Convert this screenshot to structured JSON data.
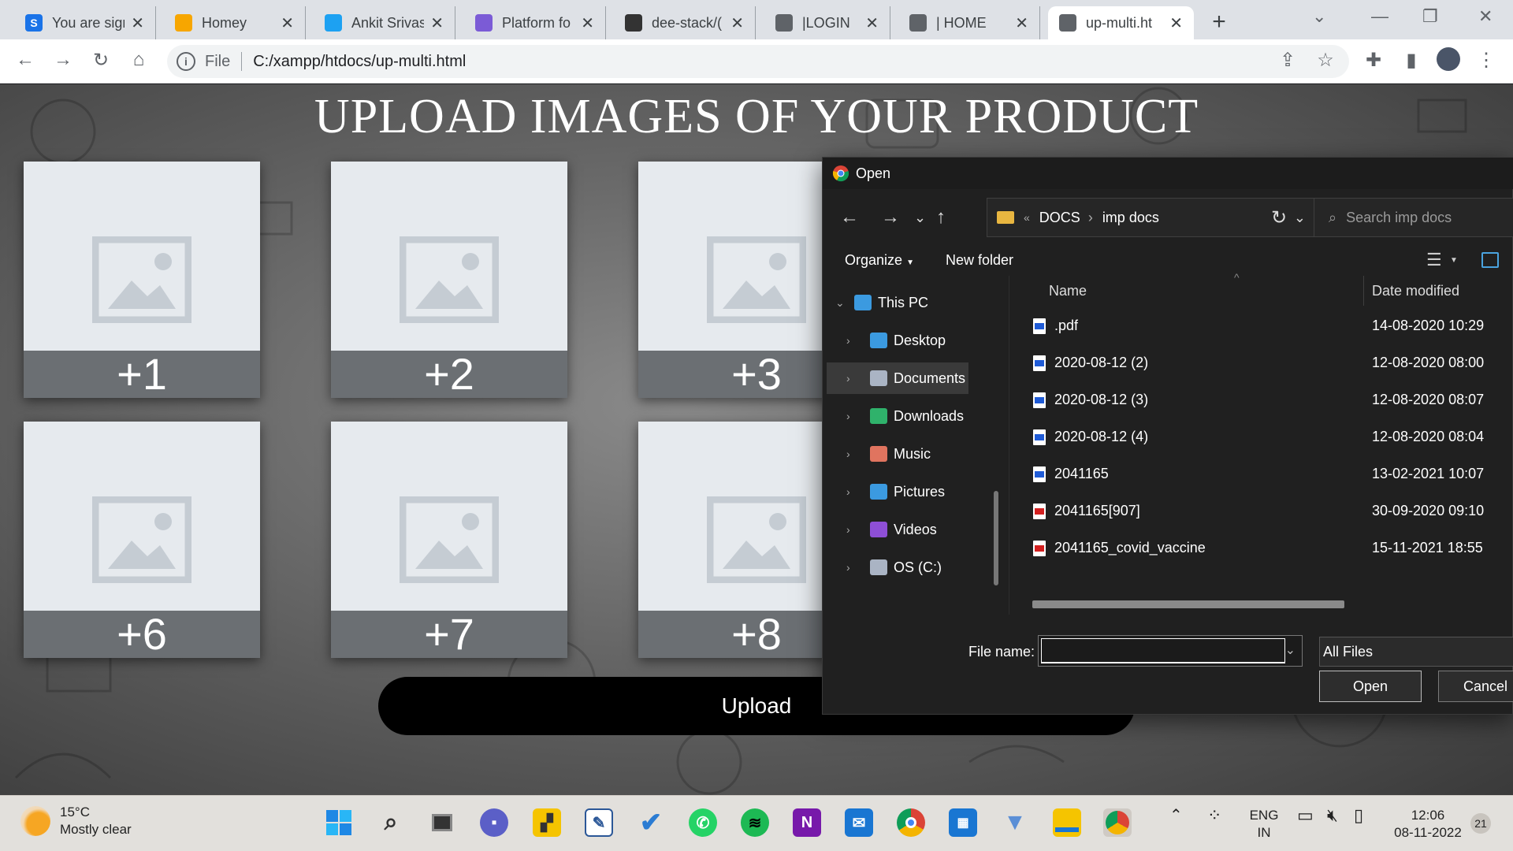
{
  "browser": {
    "tabs": [
      {
        "title": "You are sign",
        "favicon_letter": "S",
        "favicon_color": "#1a73e8",
        "active": false
      },
      {
        "title": "Homey",
        "favicon_letter": "",
        "favicon_color": "#f7a600",
        "active": false
      },
      {
        "title": "Ankit Srivas",
        "favicon_letter": "",
        "favicon_color": "#1da1f2",
        "active": false
      },
      {
        "title": "Platform fo",
        "favicon_letter": "",
        "favicon_color": "#7b5bd6",
        "active": false
      },
      {
        "title": "dee-stack/(",
        "favicon_letter": "",
        "favicon_color": "#333333",
        "active": false
      },
      {
        "title": "|LOGIN",
        "favicon_letter": "",
        "favicon_color": "#5f6368",
        "active": false
      },
      {
        "title": "| HOME",
        "favicon_letter": "",
        "favicon_color": "#5f6368",
        "active": false
      },
      {
        "title": "up-multi.ht",
        "favicon_letter": "",
        "favicon_color": "#5f6368",
        "active": true
      }
    ],
    "address": {
      "scheme_label": "File",
      "url": "C:/xampp/htdocs/up-multi.html"
    }
  },
  "page": {
    "heading": "UPLOAD IMAGES OF YOUR PRODUCT",
    "slots": [
      {
        "label": "+1"
      },
      {
        "label": "+2"
      },
      {
        "label": "+3"
      },
      {
        "label": "+6"
      },
      {
        "label": "+7"
      },
      {
        "label": "+8"
      }
    ],
    "upload_label": "Upload"
  },
  "dialog": {
    "title": "Open",
    "breadcrumb": {
      "overflow": "«",
      "parent": "DOCS",
      "current": "imp docs"
    },
    "search_placeholder": "Search imp docs",
    "organize_label": "Organize",
    "new_folder_label": "New folder",
    "nav": [
      {
        "label": "This PC",
        "icon": "pc-icon",
        "color": "#3b9ae0",
        "expanded": true
      },
      {
        "label": "Desktop",
        "icon": "desktop-icon",
        "color": "#3b9ae0"
      },
      {
        "label": "Documents",
        "icon": "documents-icon",
        "color": "#aab4c4",
        "selected": true
      },
      {
        "label": "Downloads",
        "icon": "downloads-icon",
        "color": "#2fb26b"
      },
      {
        "label": "Music",
        "icon": "music-icon",
        "color": "#e0745f"
      },
      {
        "label": "Pictures",
        "icon": "pictures-icon",
        "color": "#3b9ae0"
      },
      {
        "label": "Videos",
        "icon": "videos-icon",
        "color": "#8e4fd6"
      },
      {
        "label": "OS (C:)",
        "icon": "drive-icon",
        "color": "#aab4c4"
      }
    ],
    "columns": {
      "name": "Name",
      "date": "Date modified"
    },
    "files": [
      {
        "name": ".pdf",
        "date": "14-08-2020 10:29",
        "type": "doc"
      },
      {
        "name": "2020-08-12 (2)",
        "date": "12-08-2020 08:00",
        "type": "doc"
      },
      {
        "name": "2020-08-12 (3)",
        "date": "12-08-2020 08:07",
        "type": "doc"
      },
      {
        "name": "2020-08-12 (4)",
        "date": "12-08-2020 08:04",
        "type": "doc"
      },
      {
        "name": "2041165",
        "date": "13-02-2021 10:07",
        "type": "doc"
      },
      {
        "name": "2041165[907]",
        "date": "30-09-2020 09:10",
        "type": "pdf"
      },
      {
        "name": "2041165_covid_vaccine",
        "date": "15-11-2021 18:55",
        "type": "pdf"
      }
    ],
    "file_name_label": "File name:",
    "file_name_value": "",
    "filter_value": "All Files",
    "open_label": "Open",
    "cancel_label": "Cancel"
  },
  "taskbar": {
    "weather_temp": "15°C",
    "weather_desc": "Mostly clear",
    "lang_top": "ENG",
    "lang_bottom": "IN",
    "time": "12:06",
    "date": "08-11-2022",
    "notification_count": "21"
  }
}
